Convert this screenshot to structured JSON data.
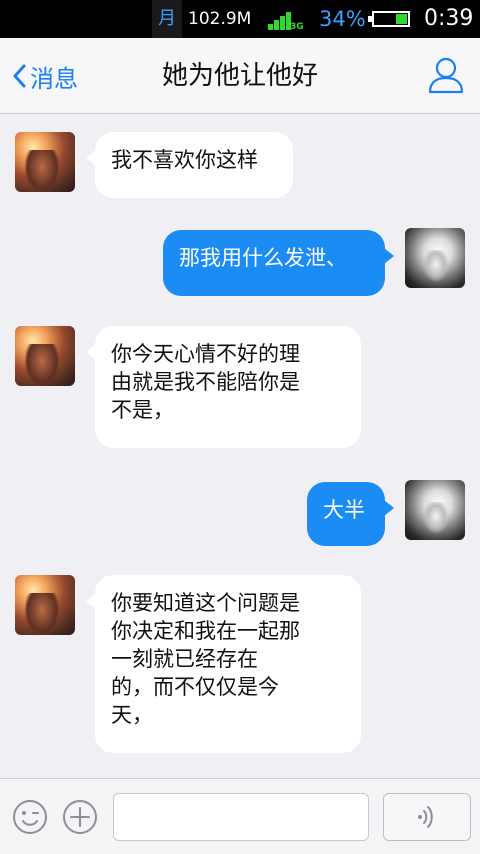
{
  "status_bar": {
    "carrier_glyph": "月",
    "network_speed": "102.9M",
    "network_type": "3G",
    "battery_percent": "34%",
    "battery_level": 0.34,
    "time": "0:39",
    "accent_color": "#3aa0ff"
  },
  "nav": {
    "back_label": "消息",
    "title": "她为他让他好",
    "profile_icon": "person-icon"
  },
  "messages": [
    {
      "side": "in",
      "text": "我不喜欢你这样"
    },
    {
      "side": "out",
      "text": "那我用什么发泄、"
    },
    {
      "side": "in",
      "text": "你今天心情不好的理\n由就是我不能陪你是\n不是，"
    },
    {
      "side": "out",
      "text": "大半"
    },
    {
      "side": "in",
      "text": "你要知道这个问题是\n你决定和我在一起那\n一刻就已经存在\n的，而不仅仅是今\n天，"
    }
  ],
  "input_bar": {
    "emoji_icon": "emoji-icon",
    "plus_icon": "plus-icon",
    "voice_icon": "voice-icon",
    "text_value": ""
  },
  "colors": {
    "outgoing_bubble": "#1c8cf5",
    "incoming_bubble": "#ffffff",
    "accent": "#1a7ff0",
    "background": "#efeff4"
  }
}
